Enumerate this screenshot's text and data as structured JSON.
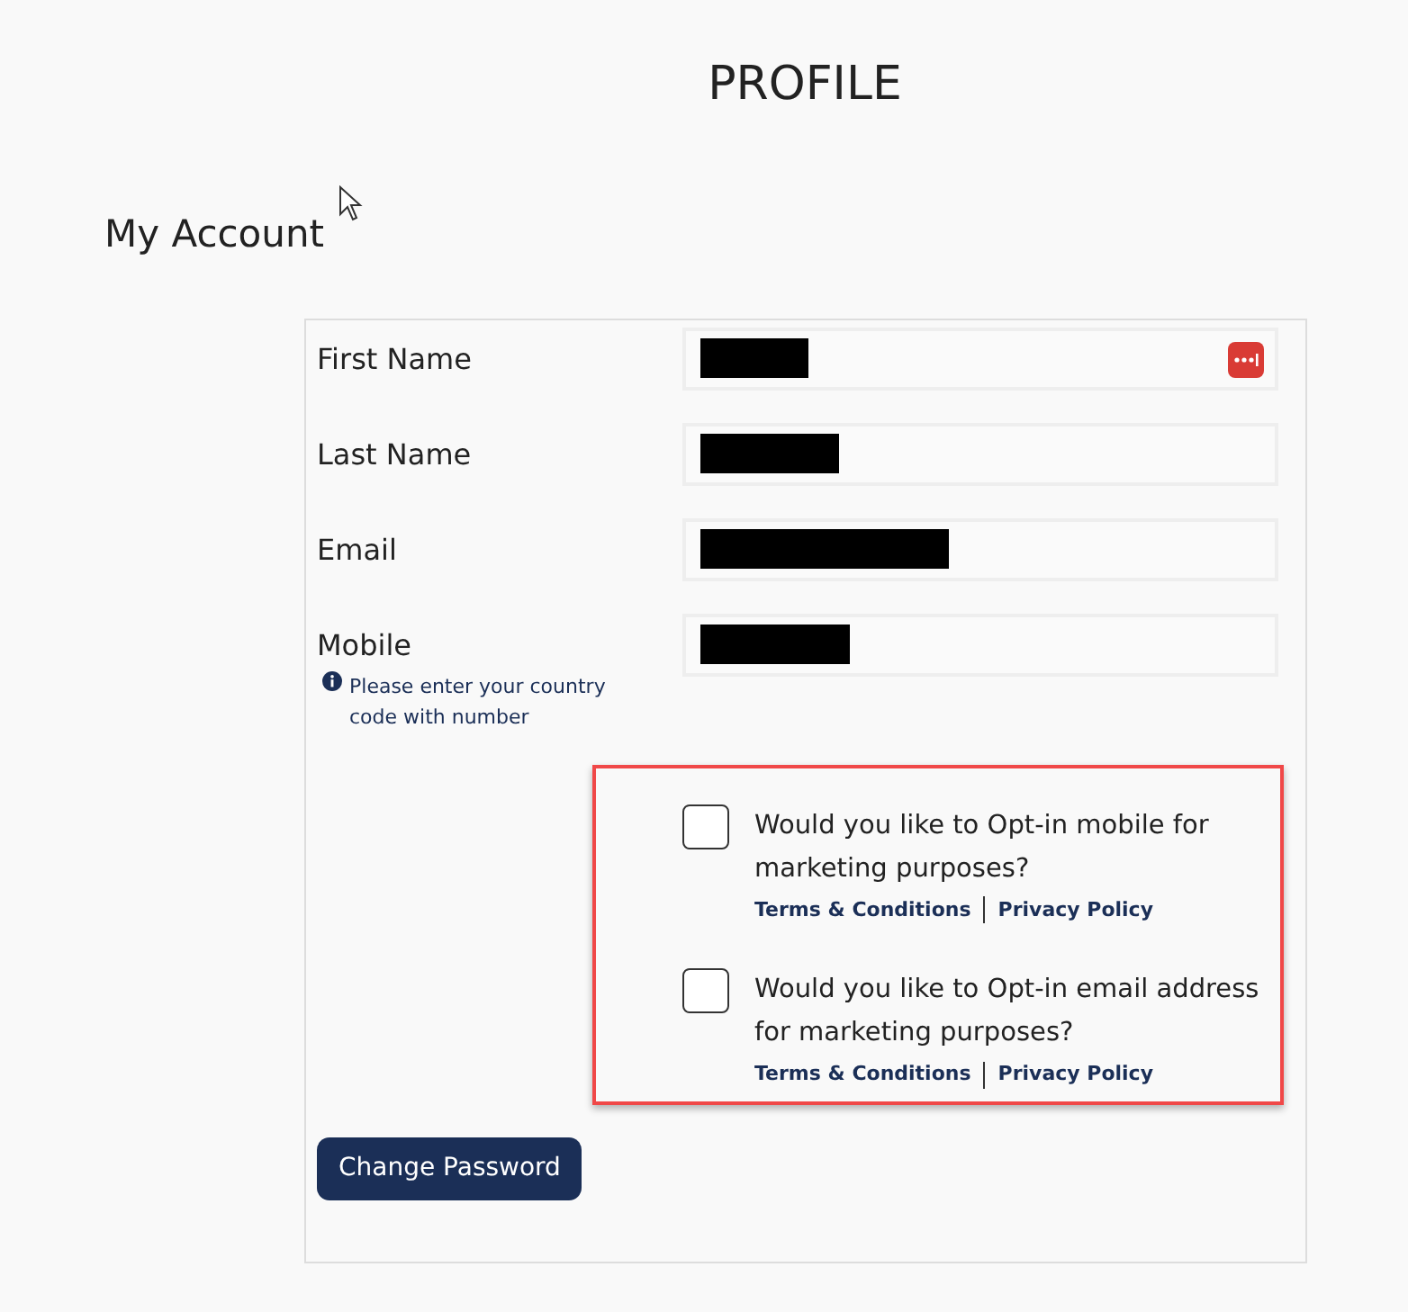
{
  "page_title": "PROFILE",
  "section_title": "My Account",
  "fields": [
    {
      "label": "First Name",
      "redacted": true,
      "password_manager": true
    },
    {
      "label": "Last Name",
      "redacted": true
    },
    {
      "label": "Email",
      "redacted": true
    },
    {
      "label": "Mobile",
      "redacted": true,
      "hint": "Please enter your country code with number"
    }
  ],
  "opt_ins": [
    {
      "text": "Would you like to Opt-in mobile for marketing purposes?",
      "checked": false,
      "links": [
        "Terms & Conditions",
        "Privacy Policy"
      ]
    },
    {
      "text": "Would you like to Opt-in email address for marketing purposes?",
      "checked": false,
      "links": [
        "Terms & Conditions",
        "Privacy Policy"
      ]
    }
  ],
  "button": "Change Password"
}
